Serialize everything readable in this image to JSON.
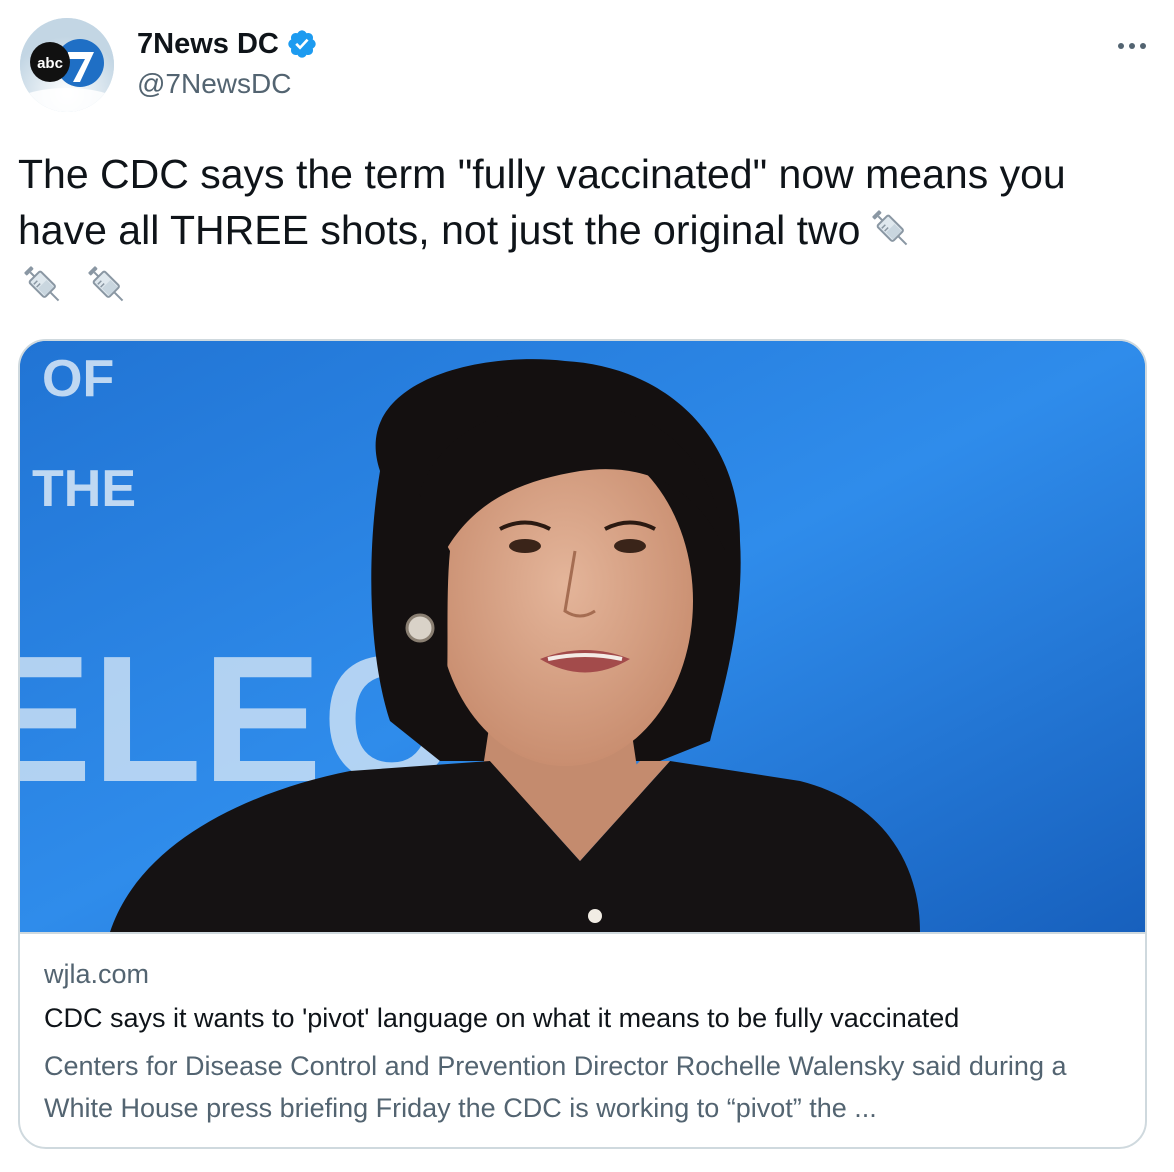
{
  "account": {
    "display_name": "7News DC",
    "handle": "@7NewsDC",
    "verified": true,
    "avatar_logo_text": "abc"
  },
  "tweet": {
    "text": "The CDC says the term \"fully vaccinated\" now means you have all THREE shots, not just the original two",
    "emoji": [
      "syringe-emoji",
      "syringe-emoji",
      "syringe-emoji"
    ]
  },
  "card": {
    "image_backdrop_text": [
      "OF",
      "THE",
      "ELECT"
    ],
    "domain": "wjla.com",
    "title": "CDC says it wants to 'pivot' language on what it means to be fully vaccinated",
    "description": "Centers for Disease Control and Prevention Director Rochelle Walensky said during a White House press briefing Friday the CDC is working to “pivot” the ..."
  },
  "colors": {
    "text_primary": "#0f1419",
    "text_secondary": "#536471",
    "verified_blue": "#1d9bf0",
    "card_border": "#cfd9de",
    "backdrop_blue": "#2a86e6"
  }
}
